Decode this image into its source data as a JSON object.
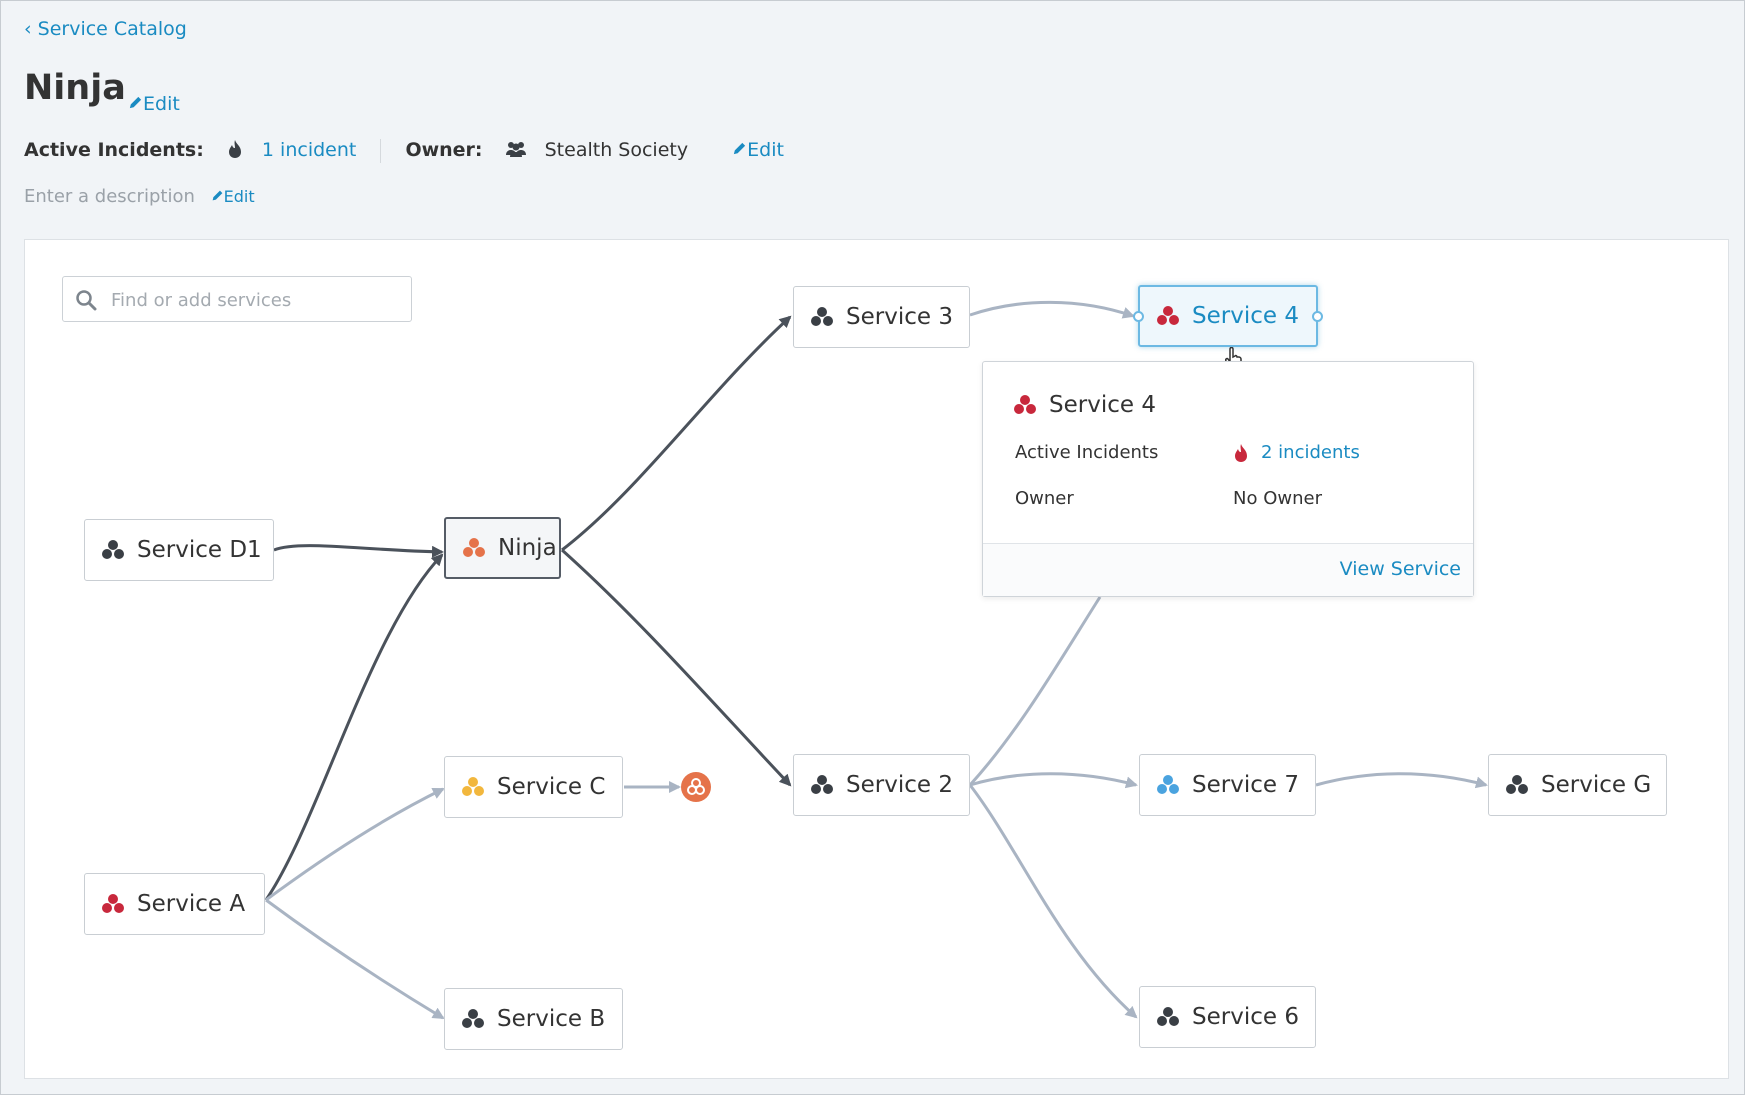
{
  "breadcrumb": {
    "label": "Service Catalog"
  },
  "service": {
    "name": "Ninja",
    "edit_label": "Edit",
    "active_incidents_label": "Active Incidents:",
    "incidents_link": "1 incident",
    "owner_label": "Owner:",
    "owner_name": "Stealth Society",
    "owner_edit_label": "Edit",
    "description_placeholder": "Enter a description",
    "description_edit_label": "Edit"
  },
  "search": {
    "placeholder": "Find or add services"
  },
  "nodes": {
    "service_d1": "Service D1",
    "ninja": "Ninja",
    "service_3": "Service 3",
    "service_4": "Service 4",
    "service_c": "Service C",
    "service_2": "Service 2",
    "service_7": "Service 7",
    "service_g": "Service G",
    "service_a": "Service A",
    "service_b": "Service B",
    "service_6": "Service 6"
  },
  "popover": {
    "title": "Service 4",
    "active_incidents_label": "Active Incidents",
    "incidents_link": "2 incidents",
    "owner_label": "Owner",
    "owner_value": "No Owner",
    "view_link": "View Service"
  },
  "colors": {
    "link": "#1a8bc2",
    "status_dark": "#3a3f45",
    "status_red": "#c8283c",
    "status_orange": "#e5734a",
    "status_yellow": "#f2b73d",
    "status_blue": "#4aa3df",
    "edge_dark": "#4b525b",
    "edge_light": "#a9b4c3"
  },
  "icons": [
    "chevron-left-icon",
    "pencil-icon",
    "flame-icon",
    "team-icon",
    "search-icon",
    "service-cubes-icon"
  ]
}
